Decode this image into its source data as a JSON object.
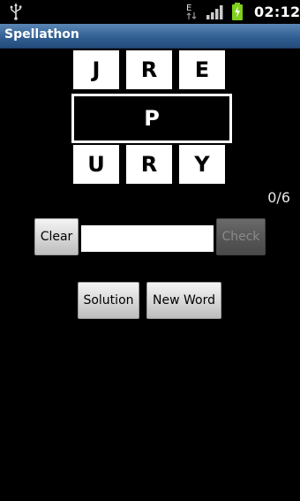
{
  "status_bar": {
    "time": "02:12",
    "network_label": "E",
    "icons": [
      "usb-icon",
      "edge-network-icon",
      "signal-icon",
      "battery-charging-icon"
    ]
  },
  "app": {
    "title": "Spellathon"
  },
  "puzzle": {
    "top_letters": [
      "J",
      "R",
      "E"
    ],
    "center_letter": "P",
    "bottom_letters": [
      "U",
      "R",
      "Y"
    ],
    "score": "0/6"
  },
  "controls": {
    "clear_label": "Clear",
    "input_value": "",
    "input_placeholder": "",
    "check_label": "Check",
    "solution_label": "Solution",
    "new_word_label": "New Word"
  },
  "colors": {
    "title_bar": "#2f5d90",
    "background": "#000000",
    "tile": "#ffffff",
    "battery": "#7fcf1d"
  }
}
